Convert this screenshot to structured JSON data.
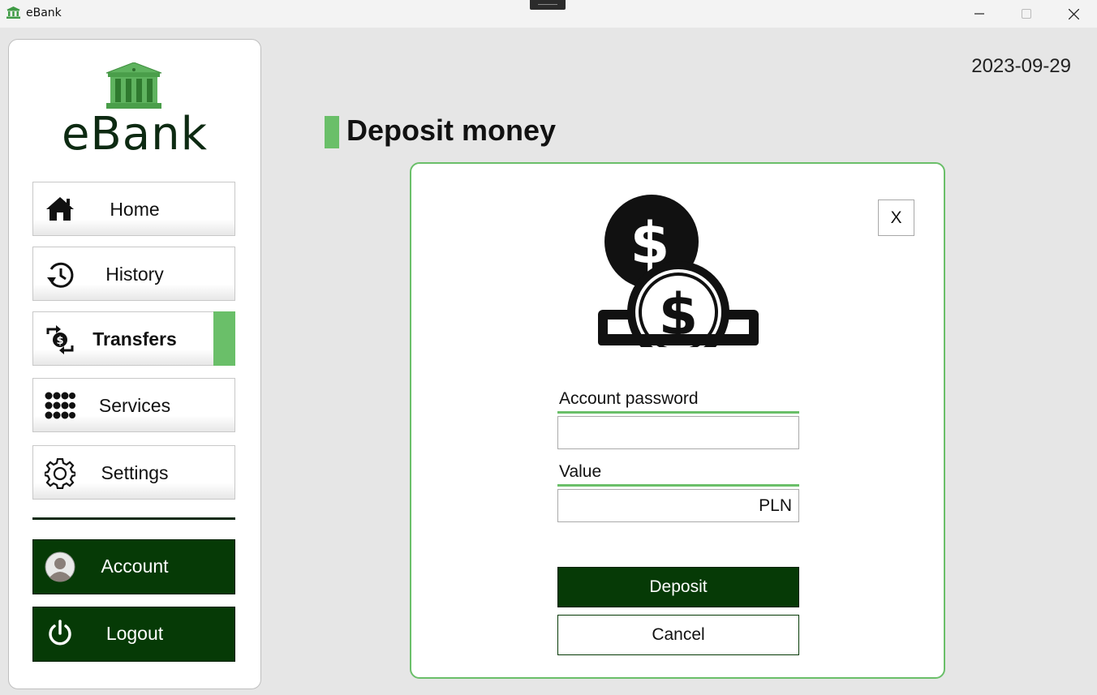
{
  "window": {
    "title": "eBank",
    "app_icon": "bank-icon",
    "controls": [
      "minimize-icon",
      "maximize-icon",
      "close-icon"
    ]
  },
  "sidebar": {
    "logo_icon": "bank-building-icon",
    "logo_text": "eBank",
    "nav_items": [
      {
        "label": "Home",
        "icon": "home-icon",
        "active": false
      },
      {
        "label": "History",
        "icon": "history-icon",
        "active": false
      },
      {
        "label": "Transfers",
        "icon": "transfer-icon",
        "active": true
      },
      {
        "label": "Services",
        "icon": "grid-dots-icon",
        "active": false
      },
      {
        "label": "Settings",
        "icon": "gear-icon",
        "active": false
      }
    ],
    "account_label": "Account",
    "account_icon": "avatar-icon",
    "logout_label": "Logout",
    "logout_icon": "power-icon"
  },
  "header": {
    "date": "2023-09-29",
    "page_title": "Deposit money"
  },
  "dialog": {
    "icon": "coins-deposit-icon",
    "close_label": "X",
    "password_label": "Account password",
    "password_value": "",
    "value_label": "Value",
    "value_value": "PLN",
    "deposit_label": "Deposit",
    "cancel_label": "Cancel"
  },
  "colors": {
    "accent_green": "#6abf69",
    "dark_green": "#063a06",
    "logo_text": "#0d2a12",
    "background": "#e6e6e6"
  }
}
